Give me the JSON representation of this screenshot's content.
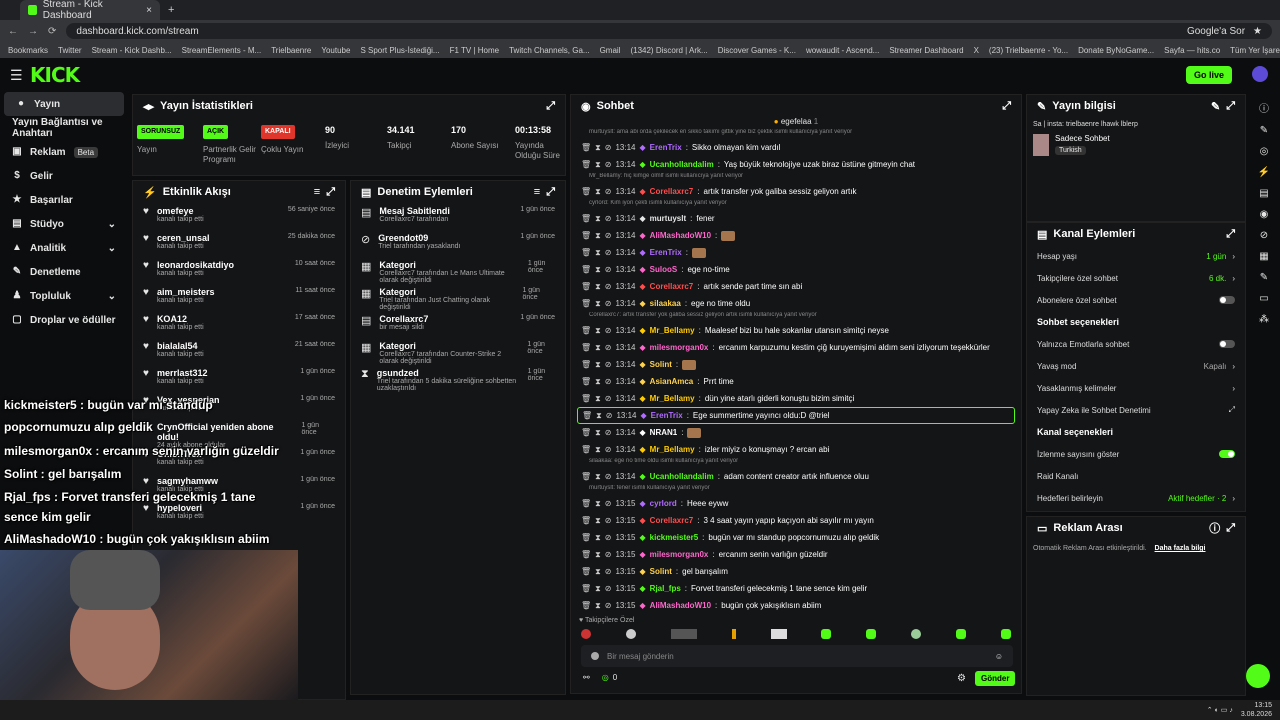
{
  "browser": {
    "tab_title": "Stream - Kick Dashboard",
    "url": "dashboard.kick.com/stream",
    "search_label": "Google'a Sor",
    "bookmarks": [
      "Bookmarks",
      "Twitter",
      "Stream - Kick Dashb...",
      "StreamElements - M...",
      "Trielbaenre",
      "Youtube",
      "S Sport Plus-İstediği...",
      "F1 TV | Home",
      "Twitch Channels, Ga...",
      "Gmail",
      "(1342) Discord | Ark...",
      "Discover Games - K...",
      "wowaudit - Ascend...",
      "Streamer Dashboard",
      "X",
      "(23) Trielbaenre - Yo...",
      "Donate ByNoGame...",
      "Sayfa — hits.co",
      "Tüm Yer İşaretleri"
    ]
  },
  "header": {
    "logo": "KICK",
    "golive": "Go live"
  },
  "sidebar": {
    "items": [
      {
        "label": "Yayın",
        "icon": "●"
      },
      {
        "label": "Yayın Bağlantısı ve Anahtarı",
        "icon": ""
      },
      {
        "label": "Reklam",
        "icon": "▣",
        "badge": "Beta"
      },
      {
        "label": "Gelir",
        "icon": "$"
      },
      {
        "label": "Başarılar",
        "icon": "★"
      },
      {
        "label": "Stüdyo",
        "icon": "▤"
      },
      {
        "label": "Analitik",
        "icon": "▲"
      },
      {
        "label": "Denetleme",
        "icon": "✎"
      },
      {
        "label": "Topluluk",
        "icon": "♟"
      },
      {
        "label": "Droplar ve ödüller",
        "icon": "▢"
      }
    ]
  },
  "stats": {
    "title": "Yayın İstatistikleri",
    "cells": [
      {
        "pill": "SORUNSUZ",
        "label": "Yayın",
        "color": "#53fc18"
      },
      {
        "pill": "AÇIK",
        "label": "Partnerlik Gelir Programı",
        "color": "#53fc18"
      },
      {
        "pill": "KAPALI",
        "label": "Çoklu Yayın",
        "color": "#e0352b"
      },
      {
        "value": "90",
        "label": "İzleyici"
      },
      {
        "value": "34.141",
        "label": "Takipçi"
      },
      {
        "value": "170",
        "label": "Abone Sayısı"
      },
      {
        "value": "00:13:58",
        "label": "Yayında Olduğu Süre"
      }
    ]
  },
  "activity": {
    "title": "Etkinlik Akışı",
    "items": [
      {
        "name": "omefeye",
        "sub": "kanalı takip etti",
        "time": "56 saniye önce"
      },
      {
        "name": "ceren_unsal",
        "sub": "kanalı takip etti",
        "time": "25 dakika önce"
      },
      {
        "name": "leonardosikatdiyo",
        "sub": "kanalı takip etti",
        "time": "10 saat önce"
      },
      {
        "name": "aim_meisters",
        "sub": "kanalı takip etti",
        "time": "11 saat önce"
      },
      {
        "name": "KOA12",
        "sub": "kanalı takip etti",
        "time": "17 saat önce"
      },
      {
        "name": "bialalal54",
        "sub": "kanalı takip etti",
        "time": "21 saat önce"
      },
      {
        "name": "merrlast312",
        "sub": "kanalı takip etti",
        "time": "1 gün önce"
      },
      {
        "name": "Vex_vesperian",
        "sub": "kanalı takip etti",
        "time": "1 gün önce"
      },
      {
        "name": "CrynOfficial yeniden abone oldu!",
        "sub": "24 aylık abone oldular",
        "time": "1 gün önce"
      },
      {
        "name": "OnionTrex",
        "sub": "kanalı takip etti",
        "time": "1 gün önce"
      },
      {
        "name": "sagmyhamww",
        "sub": "kanalı takip etti",
        "time": "1 gün önce"
      },
      {
        "name": "hypeloveri",
        "sub": "kanalı takip etti",
        "time": "1 gün önce"
      }
    ]
  },
  "moderation": {
    "title": "Denetim Eylemleri",
    "items": [
      {
        "title": "Mesaj Sabitlendi",
        "sub": "Corellaxrc7 tarafından",
        "time": "1 gün önce",
        "icon": "▤"
      },
      {
        "title": "Greendot09",
        "sub": "Triel tarafından yasaklandı",
        "time": "1 gün önce",
        "icon": "⊘"
      },
      {
        "title": "Kategori",
        "sub": "Corellaxrc7 tarafından Le Mans Ultimate olarak değiştirildi",
        "time": "1 gün önce",
        "icon": "▦"
      },
      {
        "title": "Kategori",
        "sub": "Triel tarafından Just Chatting olarak değiştirildi",
        "time": "1 gün önce",
        "icon": "▦"
      },
      {
        "title": "Corellaxrc7",
        "sub": "bir mesajı sildi",
        "time": "1 gün önce",
        "icon": "▤"
      },
      {
        "title": "Kategori",
        "sub": "Corellaxrc7 tarafından Counter-Strike 2 olarak değiştirildi",
        "time": "1 gün önce",
        "icon": "▦"
      },
      {
        "title": "gsundzed",
        "sub": "Triel tarafından 5 dakika süreliğine sohbetten uzaklaştırıldı",
        "time": "1 gün önce",
        "icon": "⧗"
      }
    ]
  },
  "chat": {
    "title": "Sohbet",
    "pinned_user": "egefelaa",
    "pinned_count": "1",
    "lines": [
      {
        "reply": "murtuyslt: ama abi orda çekilecek en sikko takımı gittik yine biz çektik isimli kullanıcıya yanıt veriyor"
      },
      {
        "time": "13:14",
        "user": "ErenTrix",
        "color": "#b06cff",
        "msg": "Sikko olmayan kim vardıl"
      },
      {
        "time": "13:14",
        "user": "Ucanhollandalim",
        "color": "#53fc18",
        "msg": "Yaş büyük teknolojiye uzak biraz üstüne gitmeyin chat"
      },
      {
        "reply": "Mr_Bellamy: hiç kimge olmlf isimli kullanıcıya yanıt veriyor"
      },
      {
        "time": "13:14",
        "user": "Corellaxrc7",
        "color": "#ff4d4d",
        "msg": "artık transfer yok galiba sessiz geliyon artık"
      },
      {
        "reply": "cyrlord: Kim iyon çekti isimli kullanıcıya yanıt veriyor"
      },
      {
        "time": "13:14",
        "user": "murtuyslt",
        "color": "#e6e6e6",
        "msg": "fener"
      },
      {
        "time": "13:14",
        "user": "AliMashadoW10",
        "color": "#ff66cc",
        "msg": ""
      },
      {
        "time": "13:14",
        "user": "ErenTrix",
        "color": "#b06cff",
        "msg": ""
      },
      {
        "time": "13:14",
        "user": "SulooS",
        "color": "#ff66cc",
        "msg": "ege no-time"
      },
      {
        "time": "13:14",
        "user": "Corellaxrc7",
        "color": "#ff4d4d",
        "msg": "artık sende part time sın abi"
      },
      {
        "time": "13:14",
        "user": "silaakaa",
        "color": "#ffd24d",
        "msg": "ege no time oldu"
      },
      {
        "reply": "Corellaxrc7: artık transfer yok galiba sessiz geliyon artık isimli kullanıcıya yanıt veriyor"
      },
      {
        "time": "13:14",
        "user": "Mr_Bellamy",
        "color": "#ffcc00",
        "msg": "Maalesef bizi bu hale sokanlar utansın simitçi neyse"
      },
      {
        "time": "13:14",
        "user": "milesmorgan0x",
        "color": "#ff66cc",
        "msg": "ercanım karpuzumu kestim çiğ kuruyemişimi aldım seni izliyorum teşekkürler"
      },
      {
        "time": "13:14",
        "user": "Solint",
        "color": "#ffd24d",
        "msg": ""
      },
      {
        "time": "13:14",
        "user": "AsianAmca",
        "color": "#ffd24d",
        "msg": "Prrt time"
      },
      {
        "time": "13:14",
        "user": "Mr_Bellamy",
        "color": "#ffcc00",
        "msg": "dün yine atarlı giderli konuştu bizim simitçi"
      },
      {
        "time": "13:14",
        "user": "ErenTrix",
        "color": "#b06cff",
        "msg": "Ege summertime yayıncı oldu:D @triel",
        "highlight": true
      },
      {
        "time": "13:14",
        "user": "NRAN1",
        "color": "#ffffff",
        "msg": ""
      },
      {
        "time": "13:14",
        "user": "Mr_Bellamy",
        "color": "#ffcc00",
        "msg": "izler miyiz o konuşmayı ? ercan abi"
      },
      {
        "reply": "silaakaa: ege no time oldu isimli kullanıcıya yanıt veriyor"
      },
      {
        "time": "13:14",
        "user": "Ucanhollandalim",
        "color": "#53fc18",
        "msg": "adam content creator artık influence oluu"
      },
      {
        "reply": "murtuyslt: fener isimli kullanıcıya yanıt veriyor"
      },
      {
        "time": "13:15",
        "user": "cyrlord",
        "color": "#b06cff",
        "msg": "Heee eyww"
      },
      {
        "time": "13:15",
        "user": "Corellaxrc7",
        "color": "#ff4d4d",
        "msg": "3 4 saat yayın yapıp kaçıyon abi sayılır mı yayın"
      },
      {
        "time": "13:15",
        "user": "kickmeister5",
        "color": "#53fc18",
        "msg": "bugün var mı standup popcornumuzu alıp geldik"
      },
      {
        "time": "13:15",
        "user": "milesmorgan0x",
        "color": "#ff66cc",
        "msg": "ercanım senin varlığın güzeldir"
      },
      {
        "time": "13:15",
        "user": "Solint",
        "color": "#ffd24d",
        "msg": "gel barışalım"
      },
      {
        "time": "13:15",
        "user": "Rjal_fps",
        "color": "#53fc18",
        "msg": "Forvet transferi gelecekmiş 1 tane sence kim gelir"
      },
      {
        "time": "13:15",
        "user": "AliMashadoW10",
        "color": "#ff66cc",
        "msg": "bugün çok yakışıklısın abiim"
      }
    ],
    "followers_only": "Takipçilere Özel",
    "input_placeholder": "Bir mesaj gönderin",
    "send": "Gönder",
    "points": "0"
  },
  "stream_info": {
    "title": "Yayın bilgisi",
    "stream_title": "Sa | insta: trielbaenre lhawk lblerp",
    "category": "Sadece Sohbet",
    "language": "Turkish"
  },
  "channel_actions": {
    "title": "Kanal Eylemleri",
    "rows": [
      {
        "label": "Hesap yaşı",
        "value": "1 gün",
        "kind": "value"
      },
      {
        "label": "Takipçilere özel sohbet",
        "value": "6 dk.",
        "kind": "value"
      },
      {
        "label": "Abonelere özel sohbet",
        "kind": "toggle",
        "on": false
      }
    ],
    "chat_section": "Sohbet seçenekleri",
    "chat_rows": [
      {
        "label": "Yalnızca Emotlarla sohbet",
        "kind": "toggle",
        "on": false
      },
      {
        "label": "Yavaş mod",
        "value": "Kapalı",
        "kind": "value"
      },
      {
        "label": "Yasaklanmış kelimeler",
        "kind": "arrow"
      },
      {
        "label": "Yapay Zeka ile Sohbet Denetimi",
        "kind": "link"
      }
    ],
    "channel_section": "Kanal seçenekleri",
    "channel_rows": [
      {
        "label": "İzlenme sayısını göster",
        "kind": "toggle",
        "on": true
      },
      {
        "label": "Raid Kanalı",
        "kind": "none"
      },
      {
        "label": "Hedefleri belirleyin",
        "value": "Aktif hedefler · 2",
        "kind": "value"
      }
    ]
  },
  "ad_break": {
    "title": "Reklam Arası",
    "text": "Otomatik Reklam Arası etkinleştirildi.",
    "link": "Daha fazla bilgi"
  },
  "overlay": {
    "lines": [
      "kickmeister5 : bugün var mı standup",
      "popcornumuzu alıp geldik",
      "milesmorgan0x : ercanım senin varlığın güzeldir",
      "Solint : gel barışalım",
      "Rjal_fps : Forvet transferi gelecekmiş 1 tane",
      "sence kim gelir",
      "AliMashadoW10 : bugün çok yakışıklısın abiim"
    ]
  },
  "taskbar": {
    "time": "13:15",
    "date": "3.08.2026"
  },
  "colors": {
    "accent": "#53fc18",
    "bg": "#0c0d0e",
    "panel": "#141517"
  }
}
